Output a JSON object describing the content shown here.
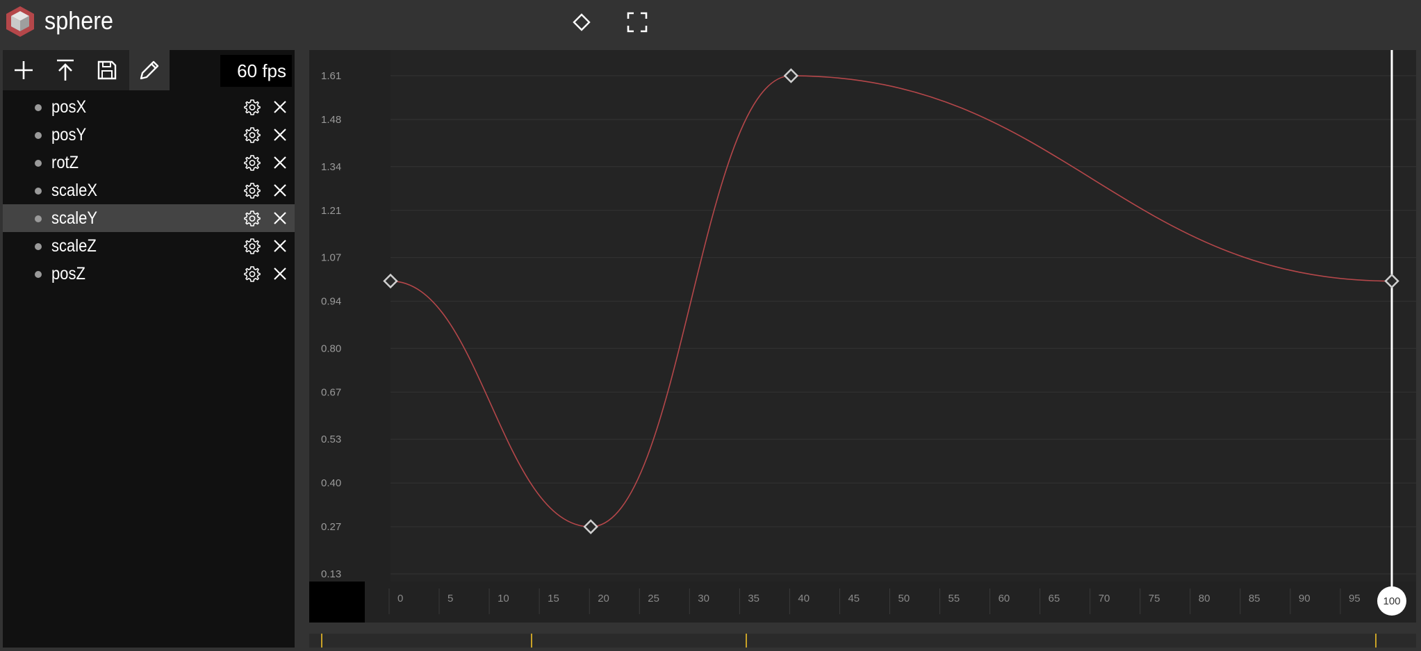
{
  "app": {
    "title": "sphere",
    "brand_color": "#b5474a",
    "icons": {
      "logo": "cube-logo",
      "keyframe": "diamond-icon",
      "fullscreen": "fullscreen-icon"
    }
  },
  "toolbar": {
    "buttons": [
      {
        "name": "add-track-button",
        "icon": "plus-icon"
      },
      {
        "name": "upload-button",
        "icon": "upload-icon"
      },
      {
        "name": "save-button",
        "icon": "save-icon"
      },
      {
        "name": "edit-button",
        "icon": "pencil-icon",
        "active": true
      }
    ],
    "fps": "60 fps"
  },
  "tracks": [
    {
      "label": "posX",
      "selected": false
    },
    {
      "label": "posY",
      "selected": false
    },
    {
      "label": "rotZ",
      "selected": false
    },
    {
      "label": "scaleX",
      "selected": false
    },
    {
      "label": "scaleY",
      "selected": true
    },
    {
      "label": "scaleZ",
      "selected": false
    },
    {
      "label": "posZ",
      "selected": false
    }
  ],
  "chart_data": {
    "type": "line",
    "series": [
      {
        "color": "#b5474a",
        "keyframes": [
          {
            "x": 0,
            "y": 1.0
          },
          {
            "x": 20,
            "y": 0.27
          },
          {
            "x": 40,
            "y": 1.61
          },
          {
            "x": 100,
            "y": 1.0
          }
        ]
      }
    ],
    "y_ticks": [
      "0.13",
      "0.27",
      "0.40",
      "0.53",
      "0.67",
      "0.80",
      "0.94",
      "1.07",
      "1.21",
      "1.34",
      "1.48",
      "1.61"
    ],
    "x_ticks": [
      "0",
      "5",
      "10",
      "15",
      "20",
      "25",
      "30",
      "35",
      "40",
      "45",
      "50",
      "55",
      "60",
      "65",
      "70",
      "75",
      "80",
      "85",
      "90",
      "95"
    ],
    "xlim": [
      0,
      100
    ],
    "ylim": [
      0.13,
      1.61
    ],
    "grid": true,
    "playhead": {
      "frame": 100,
      "label": "100"
    }
  }
}
